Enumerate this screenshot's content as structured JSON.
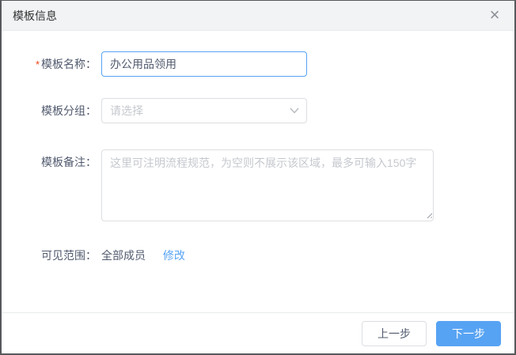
{
  "dialog": {
    "title": "模板信息",
    "close_label": "×"
  },
  "form": {
    "name_field": {
      "label": "模板名称：",
      "required_mark": "*",
      "value": "办公用品领用"
    },
    "group_field": {
      "label": "模板分组：",
      "placeholder": "请选择"
    },
    "remark_field": {
      "label": "模板备注：",
      "placeholder": "这里可注明流程规范，为空则不展示该区域，最多可输入150字",
      "value": ""
    },
    "scope_field": {
      "label": "可见范围：",
      "value": "全部成员",
      "edit_link": "修改"
    }
  },
  "footer": {
    "prev_label": "上一步",
    "next_label": "下一步"
  },
  "colors": {
    "primary_button": "#57a3f3",
    "focused_input_border": "#57a3f3",
    "link": "#57a3f3",
    "required_asterisk": "#ed4014",
    "header_background": "#f1f3f5",
    "input_border": "#dcdee2",
    "placeholder_text": "#c5c8ce"
  },
  "icons": {
    "close": "close-icon",
    "select_arrow": "chevron-down-icon"
  }
}
